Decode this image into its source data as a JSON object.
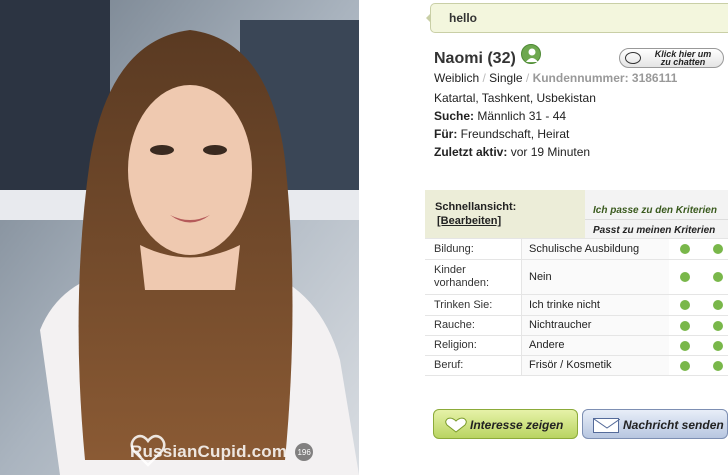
{
  "photo": {
    "watermark_text": "RussianCupid.com",
    "photo_count": "196"
  },
  "message": {
    "text": "hello"
  },
  "profile": {
    "name": "Naomi (32)",
    "gender": "Weiblich",
    "status": "Single",
    "member_label": "Kundennummer: 3186111",
    "location": "Katartal, Tashkent, Usbekistan",
    "search_label": "Suche:",
    "search_value": "Männlich 31 - 44",
    "for_label": "Für:",
    "for_value": "Freundschaft, Heirat",
    "last_active_label": "Zuletzt aktiv:",
    "last_active_value": "vor 19 Minuten",
    "online_status_color": "#6ea84f"
  },
  "chat": {
    "label_line1": "Klick hier um",
    "label_line2": "zu chatten"
  },
  "quickview": {
    "title": "Schnellansicht:",
    "edit_label": "[Bearbeiten]",
    "criteria_header_1": "Ich passe zu den Kriterien",
    "criteria_header_2": "Passt zu meinen Kriterien",
    "rows": [
      {
        "label": "Bildung:",
        "value": "Schulische Ausbildung",
        "match1": true,
        "match2": true
      },
      {
        "label": "Kinder vorhanden:",
        "value": "Nein",
        "match1": true,
        "match2": true
      },
      {
        "label": "Trinken Sie:",
        "value": "Ich trinke nicht",
        "match1": true,
        "match2": true
      },
      {
        "label": "Rauche:",
        "value": "Nichtraucher",
        "match1": true,
        "match2": true
      },
      {
        "label": "Religion:",
        "value": "Andere",
        "match1": true,
        "match2": true
      },
      {
        "label": "Beruf:",
        "value": "Frisör / Kosmetik",
        "match1": true,
        "match2": true
      }
    ],
    "match_color": "#79b74a"
  },
  "actions": {
    "interest_label": "Interesse zeigen",
    "message_label": "Nachricht senden"
  }
}
